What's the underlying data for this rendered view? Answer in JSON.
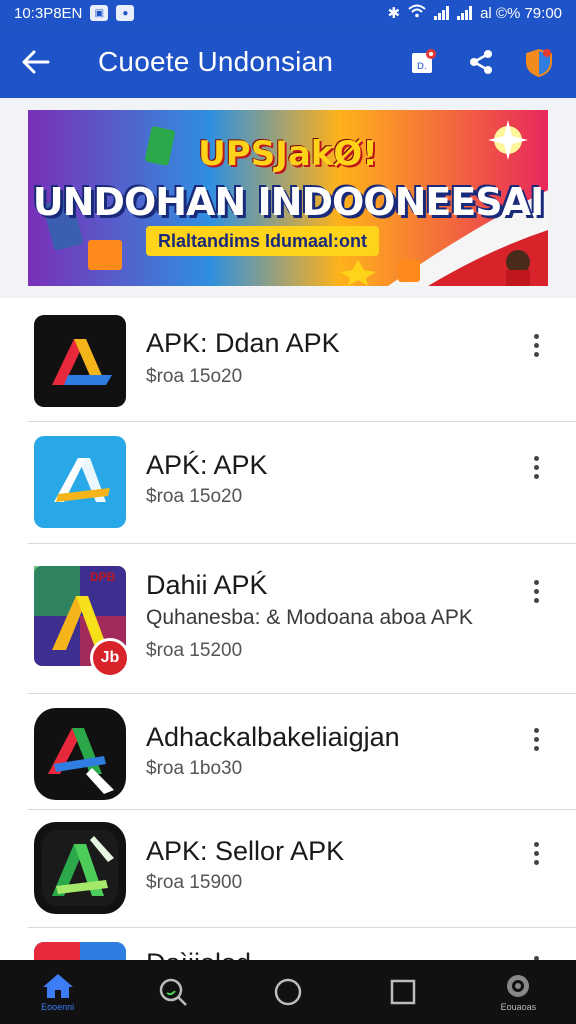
{
  "status_bar": {
    "time_left": "10:3P8EN",
    "right_status": "al ©% 79:00",
    "accent": "#1f54c9"
  },
  "app_bar": {
    "title": "Cuoete Undonsian",
    "back_icon": "back-arrow-icon",
    "actions": [
      "notification-icon",
      "share-icon",
      "shield-icon"
    ]
  },
  "banner": {
    "line1": "UPSJakØ!",
    "line2": "UNDOHAN INDOONEESAI",
    "line3": "Rlaltandims Idumaal:ont"
  },
  "apps": [
    {
      "name": "APK: Ddan APK",
      "subtitle": "",
      "meta": "$roa 15o20",
      "icon": "apk-a-red-blue"
    },
    {
      "name": "APḰ: APK",
      "subtitle": "",
      "meta": "$roa 15o20",
      "icon": "apk-a-light-blue"
    },
    {
      "name": "Dahii APḰ",
      "subtitle": "Quhanesba: & Modoana aboa APK",
      "meta": "$roa 15200",
      "icon": "apk-a-colorful",
      "badge": "Jb",
      "badge_top_label": "DPB"
    },
    {
      "name": "Adhackalbakeliaigjan",
      "subtitle": "",
      "meta": "$roa 1bo30",
      "icon": "apk-a-dark"
    },
    {
      "name": "APK: Sellor APK",
      "subtitle": "",
      "meta": "$roa 15900",
      "icon": "apk-a-green"
    },
    {
      "name": "Daìjiolod",
      "subtitle": "",
      "meta": "",
      "icon": "apk-partial"
    }
  ],
  "bottom_nav": {
    "home_label": "Eooenni",
    "settings_label": "Eouaoas",
    "items": [
      "home-icon",
      "search-icon",
      "circle-home-icon",
      "square-recents-icon",
      "settings-icon"
    ]
  }
}
